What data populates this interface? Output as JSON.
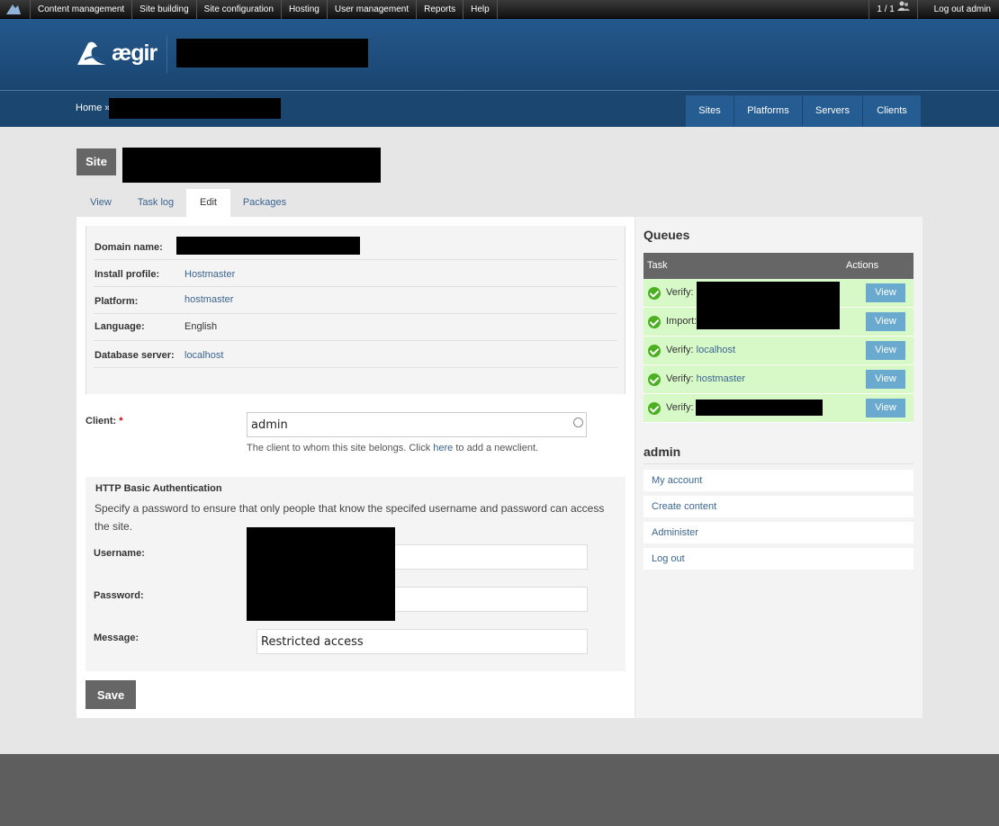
{
  "admin_bar": {
    "menu": [
      "Content management",
      "Site building",
      "Site configuration",
      "Hosting",
      "User management",
      "Reports",
      "Help"
    ],
    "user_count": "1 / 1",
    "logout": "Log out admin"
  },
  "header": {
    "brand": "ægir"
  },
  "breadcrumb": {
    "home": "Home",
    "sep": "»"
  },
  "nav_tabs": [
    "Sites",
    "Platforms",
    "Servers",
    "Clients"
  ],
  "page": {
    "badge": "Site"
  },
  "local_tabs": [
    "View",
    "Task log",
    "Edit",
    "Packages"
  ],
  "info": {
    "domain_label": "Domain name:",
    "profile_label": "Install profile:",
    "profile_value": "Hostmaster",
    "platform_label": "Platform:",
    "platform_value": "hostmaster",
    "language_label": "Language:",
    "language_value": "English",
    "db_label": "Database server:",
    "db_value": "localhost"
  },
  "client": {
    "label": "Client:",
    "required": "*",
    "value": "admin",
    "desc_before": "The client to whom this site belongs. Click ",
    "desc_link": "here",
    "desc_after": " to add a newclient."
  },
  "auth": {
    "title": "HTTP Basic Authentication",
    "desc": "Specify a password to ensure that only people that know the specifed username and password can access the site.",
    "username_label": "Username:",
    "password_label": "Password:",
    "message_label": "Message:",
    "message_value": "Restricted access"
  },
  "save_label": "Save",
  "queues": {
    "title": "Queues",
    "col_task": "Task",
    "col_actions": "Actions",
    "rows": [
      {
        "prefix": "Verify:",
        "link": ""
      },
      {
        "prefix": "Import:",
        "link": ""
      },
      {
        "prefix": "Verify:",
        "link": "localhost"
      },
      {
        "prefix": "Verify:",
        "link": "hostmaster"
      },
      {
        "prefix": "Verify:",
        "link": ""
      }
    ],
    "view_label": "View"
  },
  "admin_block": {
    "title": "admin",
    "links": [
      "My account",
      "Create content",
      "Administer",
      "Log out"
    ]
  },
  "colors": {
    "header": "#1d4a76",
    "nav_tab": "#255c92",
    "queue_row": "#d7f9c8",
    "view_button": "#6aaacf",
    "link": "#3c6592"
  }
}
